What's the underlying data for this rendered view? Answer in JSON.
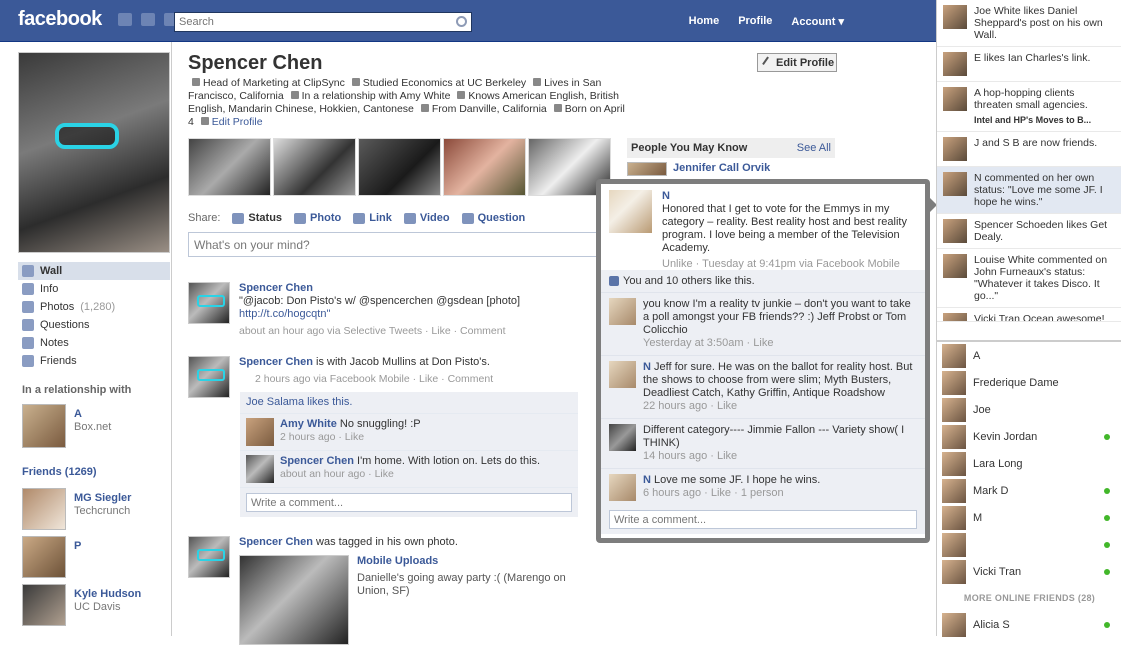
{
  "topbar": {
    "logo": "facebook",
    "search_placeholder": "Search",
    "nav": [
      "Home",
      "Profile",
      "Account ▾"
    ]
  },
  "left": {
    "nav": [
      {
        "label": "Wall",
        "count": ""
      },
      {
        "label": "Info",
        "count": ""
      },
      {
        "label": "Photos",
        "count": "(1,280)"
      },
      {
        "label": "Questions",
        "count": ""
      },
      {
        "label": "Notes",
        "count": ""
      },
      {
        "label": "Friends",
        "count": ""
      }
    ],
    "relationship_header": "In a relationship with",
    "relationship_partner": "A",
    "relationship_sub": "Box.net",
    "friends_header": "Friends (1269)",
    "friends": [
      {
        "name": "MG Siegler",
        "sub": "Techcrunch"
      },
      {
        "name": "P",
        "sub": ""
      },
      {
        "name": "Kyle Hudson",
        "sub": "UC Davis"
      }
    ]
  },
  "profile": {
    "name": "Spencer Chen",
    "edit_button": "Edit Profile",
    "info_line1": "Head of Marketing at ClipSync",
    "info_line1b": "Studied Economics at UC Berkeley",
    "info_line1c": "Lives in San Francisco, California",
    "info_line2": "In a relationship with Amy White",
    "info_line2b": "Knows American English, British English, Mandarin Chinese, Hokkien, Cantonese",
    "info_line3": "From Danville, California",
    "info_line3b": "Born on April 4",
    "info_line3c": "Edit Profile",
    "pymk_header": "People You May Know",
    "pymk_see_all": "See All",
    "pymk_name": "Jennifer Call Orvik"
  },
  "share": {
    "label": "Share:",
    "options": [
      "Status",
      "Photo",
      "Link",
      "Video",
      "Question"
    ],
    "composer_placeholder": "What's on your mind?"
  },
  "stories": [
    {
      "actor": "Spencer Chen",
      "text": "\"@jacob: Don Pisto's w/ @spencerchen @gsdean [photo]",
      "link": "http://t.co/hogcqtn\"",
      "meta": "about an hour ago via Selective Tweets · Like · Comment"
    },
    {
      "actor": "Spencer Chen",
      "text": " is with Jacob Mullins at Don Pisto's.",
      "meta": "2 hours ago via Facebook Mobile · Like · Comment",
      "likes": "Joe Salama likes this.",
      "comments": [
        {
          "name": "Amy White",
          "text": " No snuggling! :P",
          "meta": "2 hours ago · Like"
        },
        {
          "name": "Spencer Chen",
          "text": " I'm home. With lotion on. Lets do this.",
          "meta": "about an hour ago · Like"
        }
      ],
      "write_comment": "Write a comment..."
    },
    {
      "actor": "Spencer Chen",
      "text": " was tagged in his own photo.",
      "album": "Mobile Uploads",
      "caption": "Danielle's going away party :( (Marengo on Union, SF)"
    }
  ],
  "popup": {
    "author": "N",
    "status": "Honored that I get to vote for the Emmys in my category – reality. Best reality host and best reality program. I love being a member of the Television Academy.",
    "meta": "Unlike · Tuesday at 9:41pm via Facebook Mobile",
    "likes": "You and 10 others like this.",
    "comments": [
      {
        "name": "",
        "text": "you know I'm a reality tv junkie – don't you want to take a poll amongst your FB friends?? :) Jeff Probst or Tom Colicchio",
        "meta": "Yesterday at 3:50am · Like"
      },
      {
        "name": "N",
        "text": "Jeff for sure. He was on the ballot for reality host. But the shows to choose from were slim; Myth Busters, Deadliest Catch, Kathy Griffin, Antique Roadshow",
        "meta": "22 hours ago · Like"
      },
      {
        "name": "",
        "text": "Different category---- Jimmie Fallon --- Variety show( I THINK)",
        "meta": "14 hours ago · Like"
      },
      {
        "name": "N",
        "text": "Love me some JF. I hope he wins.",
        "meta": "6 hours ago · Like · 1 person"
      }
    ],
    "write_comment": "Write a comment..."
  },
  "ticker": [
    {
      "text": "Joe White likes Daniel Sheppard's post on his own Wall."
    },
    {
      "text": "E likes Ian Charles's link."
    },
    {
      "text": "A hop-hopping clients threaten small agencies.",
      "sub": "Intel and HP's Moves to B..."
    },
    {
      "text": "J and S B are now friends."
    },
    {
      "text": "N commented on her own status: \"Love me some JF. I hope he wins.\""
    },
    {
      "text": "Spencer Schoeden likes Get Dealy."
    },
    {
      "text": "Louise White commented on John Furneaux's status: \"Whatever it takes Disco. It go...\""
    },
    {
      "text": "Vicki Tran Ocean awesome!"
    }
  ],
  "chat": [
    {
      "name": "A",
      "online": false
    },
    {
      "name": "Frederique Dame",
      "online": false
    },
    {
      "name": "Joe",
      "online": false
    },
    {
      "name": "Kevin Jordan",
      "online": true
    },
    {
      "name": "Lara Long",
      "online": false
    },
    {
      "name": "Mark D",
      "online": true
    },
    {
      "name": "M",
      "online": true
    },
    {
      "name": "",
      "online": true
    },
    {
      "name": "Vicki Tran",
      "online": true
    }
  ],
  "more_friends": "MORE ONLINE FRIENDS (28)",
  "chat_last": "Alicia S"
}
